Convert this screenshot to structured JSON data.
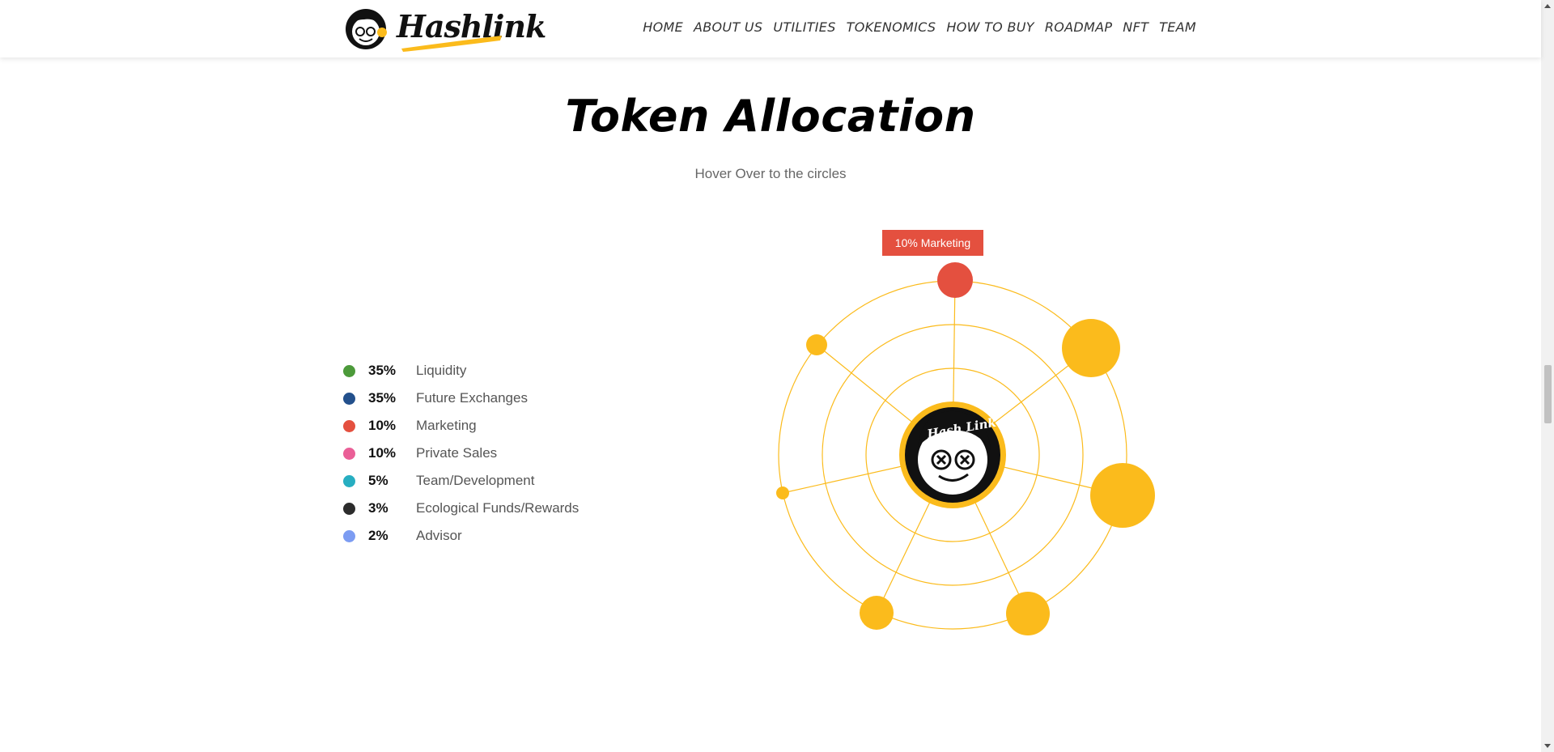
{
  "brand": {
    "name": "Hashlink",
    "center_logo_text": "Hash Link"
  },
  "nav": [
    "HOME",
    "ABOUT US",
    "UTILITIES",
    "TOKENOMICS",
    "HOW TO BUY",
    "ROADMAP",
    "NFT",
    "TEAM"
  ],
  "section": {
    "title": "Token Allocation",
    "subtitle": "Hover Over to the circles"
  },
  "tooltip": "10% Marketing",
  "legend": [
    {
      "pct": "35%",
      "label": "Liquidity",
      "color": "#4c9a3a"
    },
    {
      "pct": "35%",
      "label": "Future Exchanges",
      "color": "#23508c"
    },
    {
      "pct": "10%",
      "label": "Marketing",
      "color": "#e4503f"
    },
    {
      "pct": "10%",
      "label": "Private Sales",
      "color": "#ea5f97"
    },
    {
      "pct": "5%",
      "label": "Team/Development",
      "color": "#27aec1"
    },
    {
      "pct": "3%",
      "label": "Ecological Funds/Rewards",
      "color": "#2c2c2c"
    },
    {
      "pct": "2%",
      "label": "Advisor",
      "color": "#7c9cf2"
    }
  ],
  "colors": {
    "accent": "#fbbb1c",
    "highlight": "#e4503f"
  },
  "chart_data": {
    "type": "bubble",
    "series": [
      {
        "label": "Marketing",
        "value": 10,
        "highlighted": true
      },
      {
        "label": "Liquidity",
        "value": 35
      },
      {
        "label": "Future Exchanges",
        "value": 35
      },
      {
        "label": "Private Sales",
        "value": 10
      },
      {
        "label": "Team/Development",
        "value": 5
      },
      {
        "label": "Ecological Funds/Rewards",
        "value": 3
      },
      {
        "label": "Advisor",
        "value": 2
      }
    ]
  }
}
